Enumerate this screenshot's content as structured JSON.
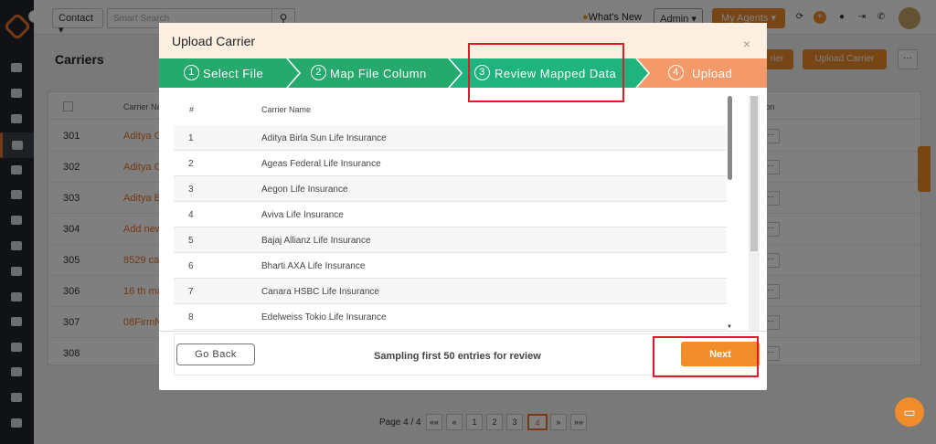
{
  "topbar": {
    "contact_select": "Contact",
    "search_placeholder": "Smart Search",
    "whats_new": "What's New",
    "role_select": "Admin",
    "agents_button": "My Agents"
  },
  "page": {
    "title": "Carriers",
    "button_partial": "rier",
    "upload_button": "Upload Carrier",
    "more": "···"
  },
  "bg_table": {
    "col_carrier": "Carrier Na",
    "col_action": "tion",
    "rows": [
      {
        "id": "301",
        "name": "Aditya C"
      },
      {
        "id": "302",
        "name": "Aditya C"
      },
      {
        "id": "303",
        "name": "Aditya Bi"
      },
      {
        "id": "304",
        "name": "Add new"
      },
      {
        "id": "305",
        "name": "8529 ca"
      },
      {
        "id": "306",
        "name": "16 th ma"
      },
      {
        "id": "307",
        "name": "08FirmN"
      },
      {
        "id": "308",
        "name": ""
      }
    ]
  },
  "pagination": {
    "label": "Page 4 / 4",
    "first": "««",
    "prev": "«",
    "pages": [
      "1",
      "2",
      "3",
      "4"
    ],
    "next": "»",
    "last": "»»"
  },
  "modal": {
    "title": "Upload Carrier",
    "close": "×",
    "steps": [
      {
        "num": "1",
        "label": "Select File"
      },
      {
        "num": "2",
        "label": "Map File Column"
      },
      {
        "num": "3",
        "label": "Review Mapped Data"
      },
      {
        "num": "4",
        "label": "Upload"
      }
    ],
    "columns": {
      "index": "#",
      "name": "Carrier Name"
    },
    "rows": [
      {
        "n": "1",
        "name": "Aditya Birla Sun Life Insurance"
      },
      {
        "n": "2",
        "name": "Ageas Federal Life Insurance"
      },
      {
        "n": "3",
        "name": "Aegon Life Insurance"
      },
      {
        "n": "4",
        "name": "Aviva Life Insurance"
      },
      {
        "n": "5",
        "name": "Bajaj Allianz Life Insurance"
      },
      {
        "n": "6",
        "name": "Bharti AXA Life Insurance"
      },
      {
        "n": "7",
        "name": "Canara HSBC Life Insurance"
      },
      {
        "n": "8",
        "name": "Edelweiss Tokio Life Insurance"
      }
    ],
    "go_back": "Go Back",
    "sampling_text": "Sampling first 50 entries for review",
    "next": "Next"
  },
  "colors": {
    "step_done": "#26a96c",
    "step_active": "#1fb37d",
    "step_pending": "#f49a6a",
    "accent": "#f08c2a",
    "highlight": "#e01b24"
  }
}
